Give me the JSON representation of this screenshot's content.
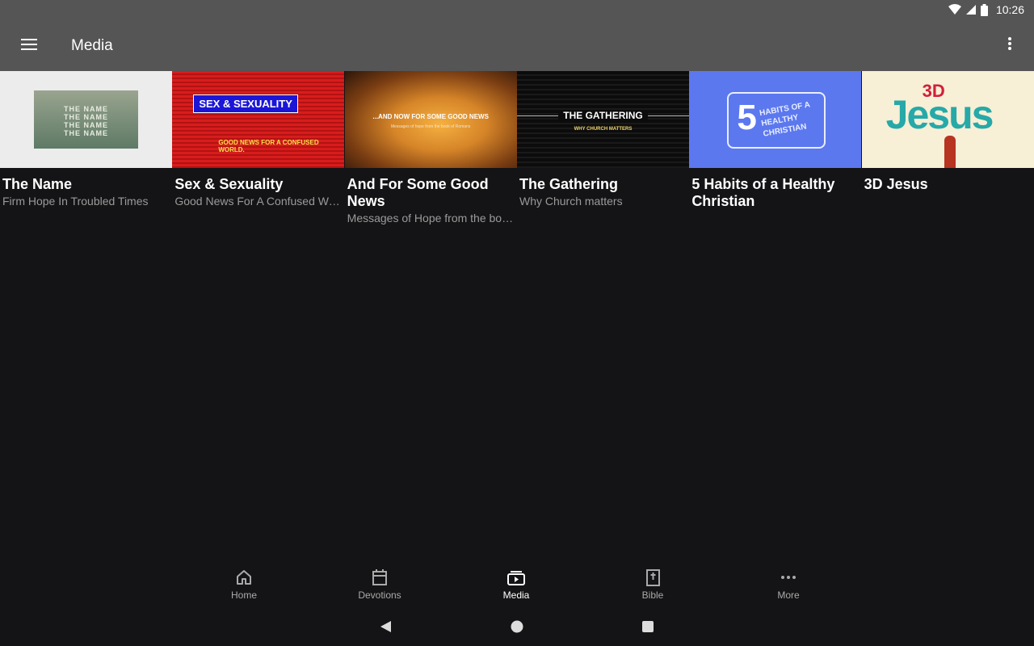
{
  "status_bar": {
    "time": "10:26"
  },
  "app_bar": {
    "title": "Media"
  },
  "media_items": [
    {
      "title": "The Name",
      "subtitle": "Firm Hope In Troubled Times",
      "thumb_text": [
        "THE NAME",
        "THE NAME",
        "THE NAME",
        "THE NAME"
      ]
    },
    {
      "title": "Sex & Sexuality",
      "subtitle": "Good News For A Confused Wo…",
      "thumb_text": [
        "SEX & SEXUALITY",
        "GOOD NEWS FOR A CONFUSED WORLD."
      ]
    },
    {
      "title": "And For Some Good News",
      "subtitle": "Messages of Hope from the bo…",
      "thumb_text": [
        "...AND NOW FOR SOME GOOD NEWS",
        "Messages of hope from the book of Romans"
      ]
    },
    {
      "title": "The Gathering",
      "subtitle": "Why Church matters",
      "thumb_text": [
        "THE GATHERING",
        "WHY CHURCH MATTERS"
      ]
    },
    {
      "title": "5 Habits of a Healthy Christian",
      "subtitle": "",
      "thumb_text": [
        "5",
        "HABITS OF A HEALTHY CHRISTIAN"
      ]
    },
    {
      "title": "3D Jesus",
      "subtitle": "",
      "thumb_text": [
        "3D",
        "Jesus"
      ]
    }
  ],
  "bottom_nav": [
    {
      "label": "Home",
      "icon": "home-icon"
    },
    {
      "label": "Devotions",
      "icon": "calendar-icon"
    },
    {
      "label": "Media",
      "icon": "video-library-icon",
      "active": true
    },
    {
      "label": "Bible",
      "icon": "bible-icon"
    },
    {
      "label": "More",
      "icon": "more-horizontal-icon"
    }
  ],
  "colors": {
    "app_bar": "#555555",
    "background": "#141416",
    "secondary_text": "#9a9a9a"
  }
}
